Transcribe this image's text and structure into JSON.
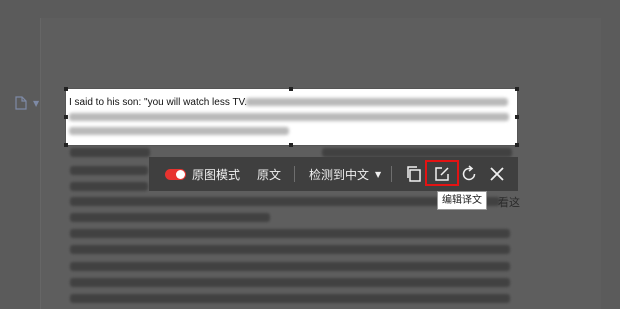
{
  "snippet": {
    "visible_text": "I said to his son: \"you will watch less TV."
  },
  "toolbar": {
    "toggle_on": true,
    "original_layout_label": "原图模式",
    "source_text_label": "原文",
    "detect_label": "检测到中文",
    "accent_color": "#e8332f"
  },
  "tooltip": {
    "text": "编辑译文"
  },
  "page": {
    "partial_text": "看这"
  },
  "icons": [
    "document-icon",
    "chevron-down-icon",
    "copy-icon",
    "edit-icon",
    "retry-icon",
    "close-icon"
  ]
}
